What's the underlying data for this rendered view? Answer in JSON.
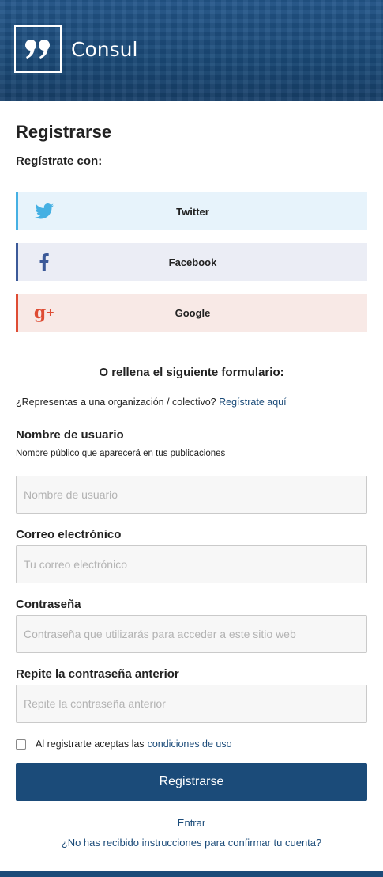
{
  "header": {
    "logo_text": "Consul"
  },
  "page": {
    "title": "Registrarse",
    "subtitle": "Regístrate con:"
  },
  "social": {
    "twitter": {
      "label": "Twitter",
      "icon": "twitter-bird-icon"
    },
    "facebook": {
      "label": "Facebook",
      "icon": "facebook-f-icon"
    },
    "google": {
      "label": "Google",
      "icon": "google-plus-icon"
    }
  },
  "divider_text": "O rellena el siguiente formulario:",
  "organization": {
    "text": "¿Representas a una organización / colectivo?",
    "link": "Regístrate aquí"
  },
  "form": {
    "username": {
      "label": "Nombre de usuario",
      "help": "Nombre público que aparecerá en tus publicaciones",
      "placeholder": "Nombre de usuario",
      "value": ""
    },
    "email": {
      "label": "Correo electrónico",
      "placeholder": "Tu correo electrónico",
      "value": ""
    },
    "password": {
      "label": "Contraseña",
      "placeholder": "Contraseña que utilizarás para acceder a este sitio web",
      "value": ""
    },
    "password_confirm": {
      "label": "Repite la contraseña anterior",
      "placeholder": "Repite la contraseña anterior",
      "value": ""
    },
    "terms": {
      "text": "Al registrarte aceptas las",
      "link": "condiciones de uso",
      "checked": false
    },
    "submit_label": "Registrarse"
  },
  "links": {
    "sign_in": "Entrar",
    "no_confirmation": "¿No has recibido instrucciones para confirmar tu cuenta?"
  },
  "colors": {
    "brand": "#1b4b79",
    "twitter": "#45b0e3",
    "facebook": "#3b5998",
    "google": "#de4c34"
  }
}
